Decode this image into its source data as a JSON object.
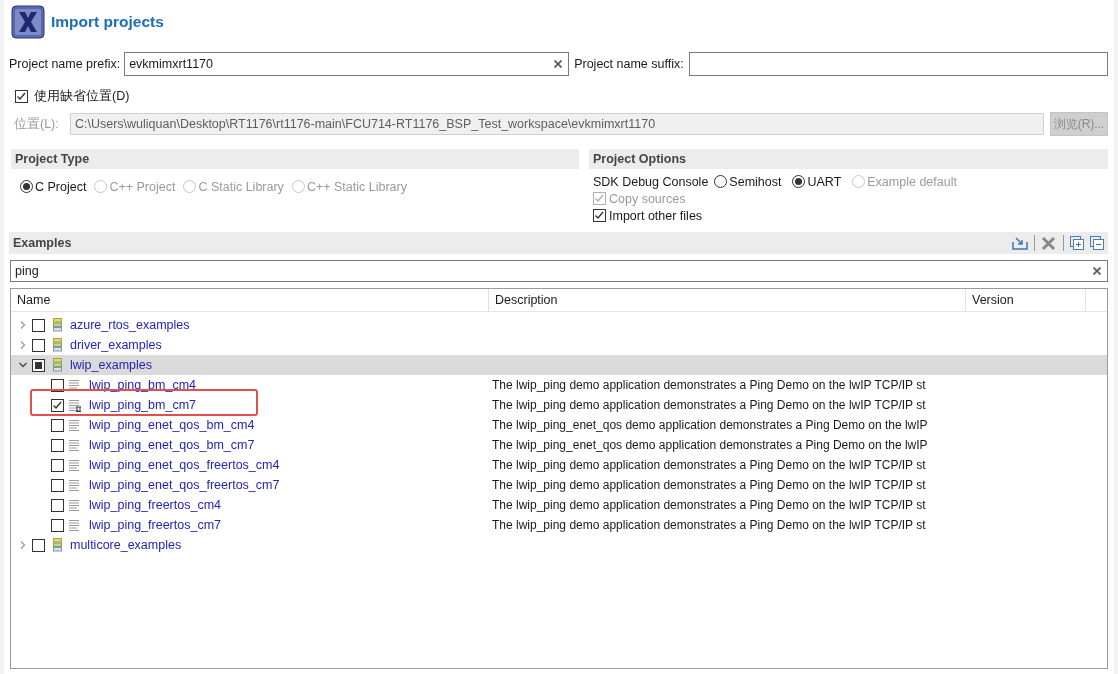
{
  "window": {
    "title": "Import projects"
  },
  "name_prefix": {
    "label": "Project name prefix:",
    "value": "evkmimxrt1170"
  },
  "name_suffix": {
    "label": "Project name suffix:"
  },
  "default_location": {
    "label": "使用缺省位置(D)",
    "checked": true
  },
  "location": {
    "label": "位置(L):",
    "value": "C:\\Users\\wuliquan\\Desktop\\RT1176\\rt1176-main\\FCU714-RT1176_BSP_Test_workspace\\evkmimxrt1170",
    "disabled": true
  },
  "browse_button": {
    "label": "浏览(R)...",
    "disabled": true
  },
  "project_type": {
    "title": "Project Type",
    "options": [
      {
        "label": "C Project",
        "selected": true,
        "disabled": false
      },
      {
        "label": "C++ Project",
        "selected": false,
        "disabled": true
      },
      {
        "label": "C Static Library",
        "selected": false,
        "disabled": true
      },
      {
        "label": "C++ Static Library",
        "selected": false,
        "disabled": true
      }
    ]
  },
  "project_options": {
    "title": "Project Options",
    "debug_console": {
      "label": "SDK Debug Console",
      "options": [
        {
          "label": "Semihost",
          "selected": false,
          "disabled": false
        },
        {
          "label": "UART",
          "selected": true,
          "disabled": false
        },
        {
          "label": "Example default",
          "selected": false,
          "disabled": true
        }
      ]
    },
    "checkboxes": [
      {
        "label": "Copy sources",
        "checked": true,
        "disabled": true
      },
      {
        "label": "Import other files",
        "checked": true,
        "disabled": false
      }
    ]
  },
  "examples": {
    "title": "Examples",
    "filter": {
      "value": "ping"
    },
    "columns": [
      "Name",
      "Description",
      "Version"
    ],
    "tree": [
      {
        "kind": "folder",
        "name": "azure_rtos_examples",
        "expanded": false,
        "checked": false,
        "partial": false,
        "selected": false
      },
      {
        "kind": "folder",
        "name": "driver_examples",
        "expanded": false,
        "checked": false,
        "partial": false,
        "selected": false
      },
      {
        "kind": "folder",
        "name": "lwip_examples",
        "expanded": true,
        "checked": false,
        "partial": true,
        "selected": true,
        "children": [
          {
            "kind": "project",
            "name": "lwip_ping_bm_cm4",
            "description": "The lwip_ping demo application demonstrates a Ping Demo on the lwIP TCP/IP st",
            "checked": false,
            "selected": false,
            "annotated": false
          },
          {
            "kind": "project",
            "name": "lwip_ping_bm_cm7",
            "description": "The lwip_ping demo application demonstrates a Ping Demo on the lwIP TCP/IP st",
            "checked": true,
            "selected": false,
            "annotated": true
          },
          {
            "kind": "project",
            "name": "lwip_ping_enet_qos_bm_cm4",
            "description": "The lwip_ping_enet_qos demo application demonstrates a Ping Demo on the lwIP",
            "checked": false,
            "selected": false,
            "annotated": false
          },
          {
            "kind": "project",
            "name": "lwip_ping_enet_qos_bm_cm7",
            "description": "The lwip_ping_enet_qos demo application demonstrates a Ping Demo on the lwIP",
            "checked": false,
            "selected": false,
            "annotated": false
          },
          {
            "kind": "project",
            "name": "lwip_ping_enet_qos_freertos_cm4",
            "description": "The lwip_ping demo application demonstrates a Ping Demo on the lwIP TCP/IP st",
            "checked": false,
            "selected": false,
            "annotated": false
          },
          {
            "kind": "project",
            "name": "lwip_ping_enet_qos_freertos_cm7",
            "description": "The lwip_ping demo application demonstrates a Ping Demo on the lwIP TCP/IP st",
            "checked": false,
            "selected": false,
            "annotated": false
          },
          {
            "kind": "project",
            "name": "lwip_ping_freertos_cm4",
            "description": "The lwip_ping demo application demonstrates a Ping Demo on the lwIP TCP/IP st",
            "checked": false,
            "selected": false,
            "annotated": false
          },
          {
            "kind": "project",
            "name": "lwip_ping_freertos_cm7",
            "description": "The lwip_ping demo application demonstrates a Ping Demo on the lwIP TCP/IP st",
            "checked": false,
            "selected": false,
            "annotated": false
          }
        ]
      },
      {
        "kind": "folder",
        "name": "multicore_examples",
        "expanded": false,
        "checked": false,
        "partial": false,
        "selected": false
      }
    ]
  }
}
